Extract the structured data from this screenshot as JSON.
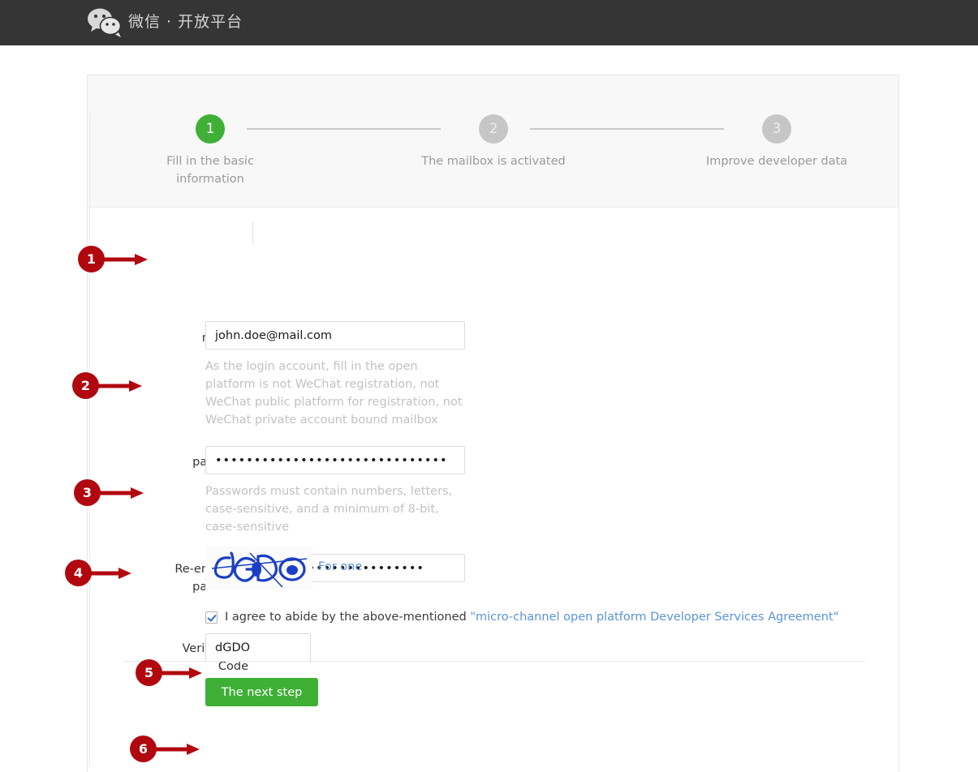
{
  "header": {
    "brand": "微信 · 开放平台",
    "logo_icon": "wechat-logo-icon"
  },
  "stepper": {
    "steps": [
      {
        "number": "1",
        "label": "Fill in the basic information",
        "state": "active"
      },
      {
        "number": "2",
        "label": "The mailbox is activated",
        "state": "inactive"
      },
      {
        "number": "3",
        "label": "Improve developer data",
        "state": "inactive"
      }
    ]
  },
  "form": {
    "mailbox": {
      "label": "mailbox",
      "value": "john.doe@mail.com",
      "placeholder": "",
      "hint": "As the login account, fill in the open platform is not WeChat registration, not WeChat public platform for registration, not WeChat private account bound mailbox"
    },
    "password": {
      "label": "password",
      "value": "••••••••••••••••••••••••••••••",
      "placeholder": "",
      "hint": "Passwords must contain numbers, letters, case-sensitive, and a minimum of 8-bit, case-sensitive"
    },
    "confirm_password": {
      "label": "Re-enter the password",
      "value": "•••••••••••••••••••••••••••",
      "placeholder": ""
    },
    "verification_code": {
      "label": "Verification Code",
      "value": "dGDO",
      "placeholder": "",
      "captcha_text": "dGDO",
      "refresh_link": "For one"
    },
    "agreement": {
      "checked": true,
      "text_prefix": "I agree to abide by the above-mentioned ",
      "link_text": "\"micro-channel open platform Developer Services Agreement\""
    },
    "submit_label": "The next step"
  },
  "annotations": [
    {
      "number": "1"
    },
    {
      "number": "2"
    },
    {
      "number": "3"
    },
    {
      "number": "4"
    },
    {
      "number": "5"
    },
    {
      "number": "6"
    }
  ],
  "colors": {
    "brand_green": "#3eb035",
    "header_dark": "#353535",
    "link_blue": "#5b93d6",
    "annotation_red": "#b1070f"
  }
}
